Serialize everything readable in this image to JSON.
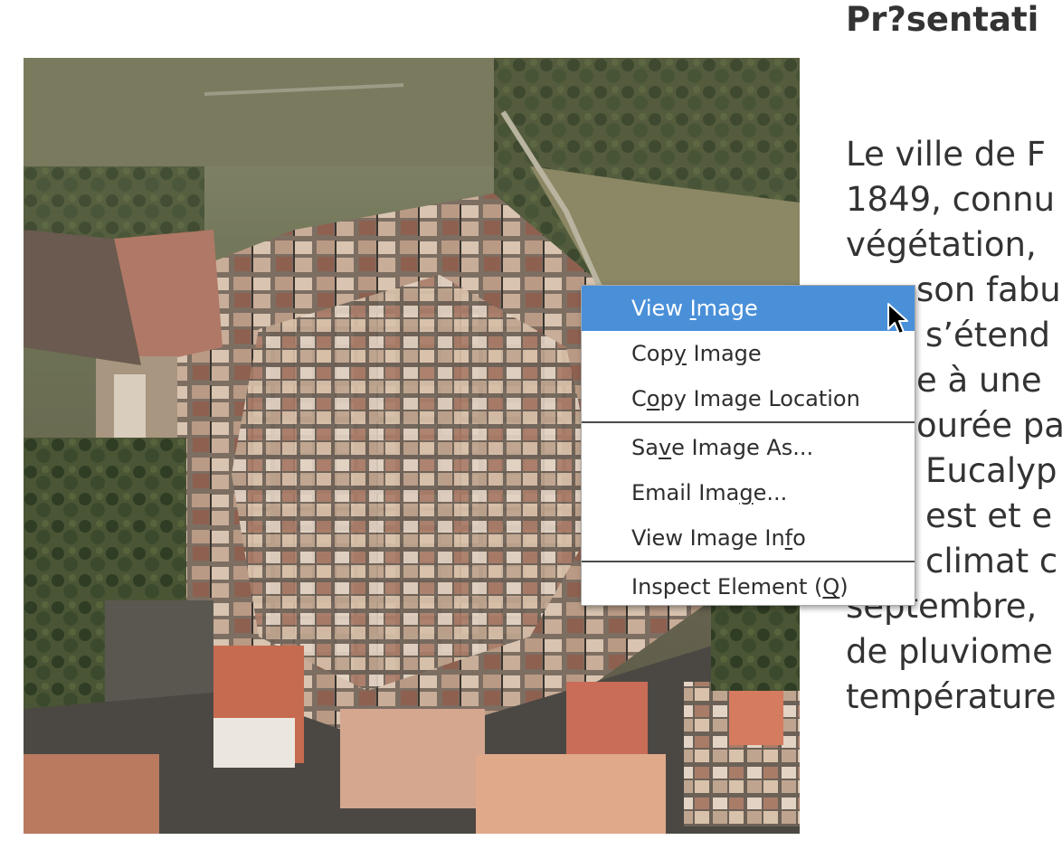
{
  "article": {
    "heading": "Pr?sentati",
    "lines": [
      "Le ville de F",
      "1849, connu",
      "végétation,",
      "son fabuleu",
      "s’étend",
      "e à une",
      "ourée pa",
      "Eucalyp",
      "est et e",
      "climat c",
      "septembre,",
      "de pluviome",
      "température"
    ]
  },
  "context_menu": {
    "items": [
      {
        "before": "View ",
        "key": "I",
        "after": "mage",
        "state": "highlighted"
      },
      {
        "before": "Cop",
        "key": "y",
        "after": " Image"
      },
      {
        "before": "C",
        "key": "o",
        "after": "py Image Location"
      },
      {
        "before": "Sa",
        "key": "v",
        "after": "e Image As..."
      },
      {
        "before": "Email Ima",
        "key": "g",
        "after": "e..."
      },
      {
        "before": "View Image In",
        "key": "f",
        "after": "o"
      },
      {
        "before": "Inspect Element (",
        "key": "Q",
        "after": ")"
      }
    ]
  },
  "colors": {
    "highlight": "#4a90d9",
    "text": "#333333",
    "menu_border": "#a8a8a8"
  },
  "icons": {
    "cursor": "arrow-cursor-icon"
  }
}
